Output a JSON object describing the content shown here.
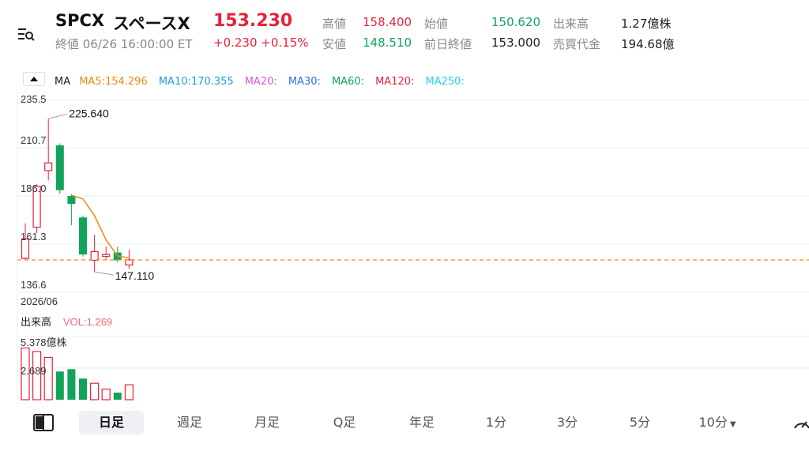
{
  "header": {
    "ticker": "SPCX",
    "name": "スペースX",
    "price": "153.230",
    "close_info": "終値 06/26 16:00:00 ET",
    "change": "+0.230 +0.15%",
    "stats": {
      "high_label": "高値",
      "high_value": "158.400",
      "open_label": "始値",
      "open_value": "150.620",
      "volume_label": "出来高",
      "volume_value": "1.27億株",
      "low_label": "安値",
      "low_value": "148.510",
      "prev_close_label": "前日終値",
      "prev_close_value": "153.000",
      "turnover_label": "売買代金",
      "turnover_value": "194.68億"
    }
  },
  "ma_bar": {
    "label": "MA",
    "items": [
      {
        "text": "MA5:154.296",
        "color": "#f08a10"
      },
      {
        "text": "MA10:170.355",
        "color": "#1e9be0"
      },
      {
        "text": "MA20:",
        "color": "#e055d8"
      },
      {
        "text": "MA30:",
        "color": "#2a6fe0"
      },
      {
        "text": "MA60:",
        "color": "#12a35a"
      },
      {
        "text": "MA120:",
        "color": "#e8223b"
      },
      {
        "text": "MA250:",
        "color": "#22d4e6"
      }
    ]
  },
  "chart_data": {
    "type": "candlestick",
    "y_ticks": [
      "235.5",
      "210.7",
      "186.0",
      "161.3",
      "136.6"
    ],
    "ylim": [
      136.6,
      235.5
    ],
    "x_label": "2026/06",
    "max_label": "225.640",
    "min_label": "147.110",
    "current_price": 153.23,
    "candles": [
      {
        "open": 154,
        "close": 164,
        "high": 172,
        "low": 153
      },
      {
        "open": 170,
        "close": 191,
        "high": 192,
        "low": 167
      },
      {
        "open": 199,
        "close": 203,
        "high": 225.64,
        "low": 194
      },
      {
        "open": 212,
        "close": 189,
        "high": 213,
        "low": 187
      },
      {
        "open": 186,
        "close": 182,
        "high": 187,
        "low": 171
      },
      {
        "open": 175,
        "close": 156,
        "high": 176,
        "low": 155
      },
      {
        "open": 153,
        "close": 157.5,
        "high": 166,
        "low": 147.11
      },
      {
        "open": 155,
        "close": 156,
        "high": 160,
        "low": 153
      },
      {
        "open": 157,
        "close": 153,
        "high": 160,
        "low": 152
      },
      {
        "open": 150.62,
        "close": 153.23,
        "high": 158.4,
        "low": 148.51
      }
    ],
    "ma5": [
      null,
      null,
      null,
      null,
      186.4,
      184.5,
      175.9,
      163.5,
      155.2,
      154.3
    ],
    "volume": {
      "label": "出来高",
      "vol_text": "VOL:1.269",
      "ticks": [
        "5.378億株",
        "2.689"
      ],
      "max": 5.378,
      "values": [
        4.4,
        4.1,
        3.6,
        2.4,
        2.6,
        1.8,
        1.4,
        0.9,
        0.6,
        1.27
      ]
    }
  },
  "tabs": [
    {
      "label": "日足",
      "active": true
    },
    {
      "label": "週足"
    },
    {
      "label": "月足"
    },
    {
      "label": "Q足"
    },
    {
      "label": "年足"
    },
    {
      "label": "1分"
    },
    {
      "label": "3分"
    },
    {
      "label": "5分"
    },
    {
      "label": "10分"
    }
  ]
}
